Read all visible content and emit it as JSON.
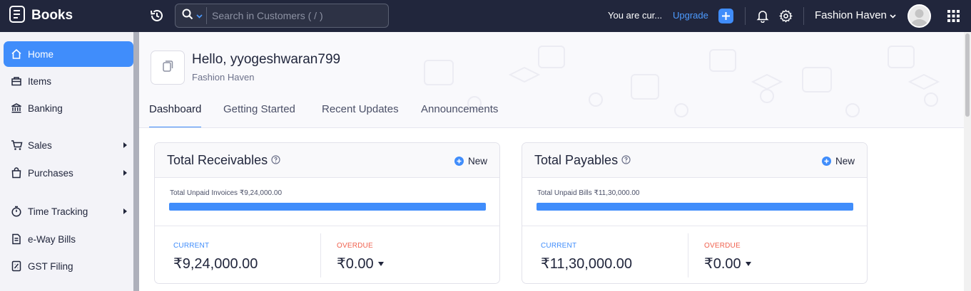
{
  "app": {
    "brand": "Books"
  },
  "topbar": {
    "search_placeholder": "Search in Customers ( / )",
    "trial_text": "You are cur...",
    "upgrade_label": "Upgrade",
    "org_name": "Fashion Haven"
  },
  "sidebar": {
    "items": [
      {
        "label": "Home",
        "icon": "home-icon",
        "active": true
      },
      {
        "label": "Items",
        "icon": "items-icon"
      },
      {
        "label": "Banking",
        "icon": "bank-icon"
      },
      {
        "label": "Sales",
        "icon": "cart-icon",
        "has_submenu": true
      },
      {
        "label": "Purchases",
        "icon": "bag-icon",
        "has_submenu": true
      },
      {
        "label": "Time Tracking",
        "icon": "timer-icon",
        "has_submenu": true
      },
      {
        "label": "e-Way Bills",
        "icon": "truck-icon"
      },
      {
        "label": "GST Filing",
        "icon": "gst-icon"
      }
    ]
  },
  "header": {
    "greeting": "Hello, yyogeshwaran799",
    "org_name": "Fashion Haven",
    "tabs": [
      {
        "label": "Dashboard",
        "active": true
      },
      {
        "label": "Getting Started"
      },
      {
        "label": "Recent Updates"
      },
      {
        "label": "Announcements"
      }
    ]
  },
  "cards": {
    "receivables": {
      "title": "Total Receivables",
      "new_label": "New",
      "unpaid_label": "Total Unpaid Invoices ₹9,24,000.00",
      "current_pct": 100,
      "current_label": "CURRENT",
      "current_amount": "₹9,24,000.00",
      "overdue_label": "OVERDUE",
      "overdue_amount": "₹0.00"
    },
    "payables": {
      "title": "Total Payables",
      "new_label": "New",
      "unpaid_label": "Total Unpaid Bills ₹11,30,000.00",
      "current_pct": 100,
      "current_label": "CURRENT",
      "current_amount": "₹11,30,000.00",
      "overdue_label": "OVERDUE",
      "overdue_amount": "₹0.00"
    }
  },
  "colors": {
    "topbar": "#21263c",
    "accent": "#408dfb",
    "overdue": "#f0614e",
    "sidebar": "#f3f3f8"
  }
}
